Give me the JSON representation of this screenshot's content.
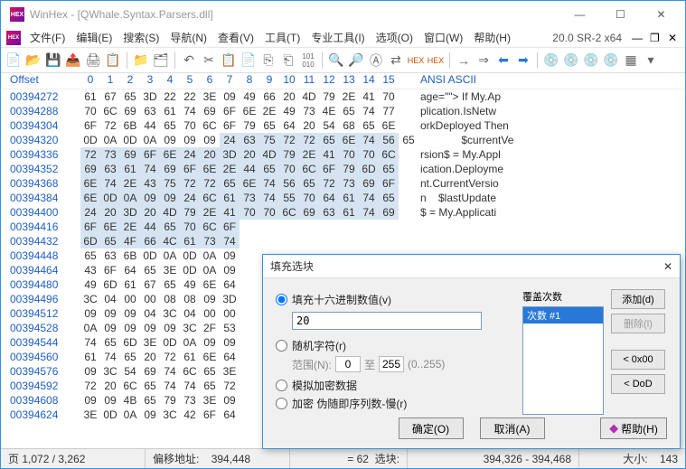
{
  "window": {
    "title": "WinHex - [QWhale.Syntax.Parsers.dll]",
    "version": "20.0 SR-2 x64"
  },
  "menus": [
    "文件(F)",
    "编辑(E)",
    "搜索(S)",
    "导航(N)",
    "查看(V)",
    "工具(T)",
    "专业工具(I)",
    "选项(O)",
    "窗口(W)",
    "帮助(H)"
  ],
  "hex": {
    "offset": "Offset",
    "ansi": "ANSI ASCII",
    "cols": [
      "0",
      "1",
      "2",
      "3",
      "4",
      "5",
      "6",
      "7",
      "8",
      "9",
      "10",
      "11",
      "12",
      "13",
      "14",
      "15"
    ],
    "rows": [
      {
        "o": "00394272",
        "h": [
          "61",
          "67",
          "65",
          "3D",
          "22",
          "22",
          "3E",
          "09",
          "49",
          "66",
          "20",
          "4D",
          "79",
          "2E",
          "41",
          "70"
        ],
        "sel": [],
        "a": "age=\"\"> If My.Ap"
      },
      {
        "o": "00394288",
        "h": [
          "70",
          "6C",
          "69",
          "63",
          "61",
          "74",
          "69",
          "6F",
          "6E",
          "2E",
          "49",
          "73",
          "4E",
          "65",
          "74",
          "77"
        ],
        "sel": [],
        "a": "plication.IsNetw"
      },
      {
        "o": "00394304",
        "h": [
          "6F",
          "72",
          "6B",
          "44",
          "65",
          "70",
          "6C",
          "6F",
          "79",
          "65",
          "64",
          "20",
          "54",
          "68",
          "65",
          "6E"
        ],
        "sel": [],
        "a": "orkDeployed Then"
      },
      {
        "o": "00394320",
        "h": [
          "0D",
          "0A",
          "0D",
          "0A",
          "09",
          "09",
          "09",
          "24",
          "63",
          "75",
          "72",
          "72",
          "65",
          "6E",
          "74",
          "56",
          "65"
        ],
        "sel": [
          7,
          8,
          9,
          10,
          11,
          12,
          13,
          14,
          15
        ],
        "a": "       $currentVe"
      },
      {
        "o": "00394336",
        "h": [
          "72",
          "73",
          "69",
          "6F",
          "6E",
          "24",
          "20",
          "3D",
          "20",
          "4D",
          "79",
          "2E",
          "41",
          "70",
          "70",
          "6C"
        ],
        "sel": [
          0,
          1,
          2,
          3,
          4,
          5,
          6,
          7,
          8,
          9,
          10,
          11,
          12,
          13,
          14,
          15
        ],
        "a": "rsion$ = My.Appl"
      },
      {
        "o": "00394352",
        "h": [
          "69",
          "63",
          "61",
          "74",
          "69",
          "6F",
          "6E",
          "2E",
          "44",
          "65",
          "70",
          "6C",
          "6F",
          "79",
          "6D",
          "65"
        ],
        "sel": [
          0,
          1,
          2,
          3,
          4,
          5,
          6,
          7,
          8,
          9,
          10,
          11,
          12,
          13,
          14,
          15
        ],
        "a": "ication.Deployme"
      },
      {
        "o": "00394368",
        "h": [
          "6E",
          "74",
          "2E",
          "43",
          "75",
          "72",
          "72",
          "65",
          "6E",
          "74",
          "56",
          "65",
          "72",
          "73",
          "69",
          "6F"
        ],
        "sel": [
          0,
          1,
          2,
          3,
          4,
          5,
          6,
          7,
          8,
          9,
          10,
          11,
          12,
          13,
          14,
          15
        ],
        "a": "nt.CurrentVersio"
      },
      {
        "o": "00394384",
        "h": [
          "6E",
          "0D",
          "0A",
          "09",
          "09",
          "24",
          "6C",
          "61",
          "73",
          "74",
          "55",
          "70",
          "64",
          "61",
          "74",
          "65"
        ],
        "sel": [
          0,
          1,
          2,
          3,
          4,
          5,
          6,
          7,
          8,
          9,
          10,
          11,
          12,
          13,
          14,
          15
        ],
        "a": "n    $lastUpdate"
      },
      {
        "o": "00394400",
        "h": [
          "24",
          "20",
          "3D",
          "20",
          "4D",
          "79",
          "2E",
          "41",
          "70",
          "70",
          "6C",
          "69",
          "63",
          "61",
          "74",
          "69"
        ],
        "sel": [
          0,
          1,
          2,
          3,
          4,
          5,
          6,
          7,
          8,
          9,
          10,
          11,
          12,
          13,
          14,
          15
        ],
        "a": "$ = My.Applicati"
      },
      {
        "o": "00394416",
        "h": [
          "6F",
          "6E",
          "2E",
          "44",
          "65",
          "70",
          "6C",
          "6F"
        ],
        "sel": [
          0,
          1,
          2,
          3,
          4,
          5,
          6,
          7
        ],
        "a": ""
      },
      {
        "o": "00394432",
        "h": [
          "6D",
          "65",
          "4F",
          "66",
          "4C",
          "61",
          "73",
          "74"
        ],
        "sel": [
          0,
          1,
          2,
          3,
          4,
          5,
          6,
          7
        ],
        "a": ""
      },
      {
        "o": "00394448",
        "h": [
          "65",
          "63",
          "6B",
          "0D",
          "0A",
          "0D",
          "0A",
          "09"
        ],
        "sel": [],
        "a": ""
      },
      {
        "o": "00394464",
        "h": [
          "43",
          "6F",
          "64",
          "65",
          "3E",
          "0D",
          "0A",
          "09"
        ],
        "sel": [],
        "a": ""
      },
      {
        "o": "00394480",
        "h": [
          "49",
          "6D",
          "61",
          "67",
          "65",
          "49",
          "6E",
          "64"
        ],
        "sel": [],
        "a": ""
      },
      {
        "o": "00394496",
        "h": [
          "3C",
          "04",
          "00",
          "00",
          "08",
          "08",
          "09",
          "3D"
        ],
        "sel": [],
        "a": ""
      },
      {
        "o": "00394512",
        "h": [
          "09",
          "09",
          "09",
          "04",
          "3C",
          "04",
          "00",
          "00"
        ],
        "sel": [],
        "a": ""
      },
      {
        "o": "00394528",
        "h": [
          "0A",
          "09",
          "09",
          "09",
          "09",
          "3C",
          "2F",
          "53"
        ],
        "sel": [],
        "a": ""
      },
      {
        "o": "00394544",
        "h": [
          "74",
          "65",
          "6D",
          "3E",
          "0D",
          "0A",
          "09",
          "09"
        ],
        "sel": [],
        "a": ""
      },
      {
        "o": "00394560",
        "h": [
          "61",
          "74",
          "65",
          "20",
          "72",
          "61",
          "6E",
          "64"
        ],
        "sel": [],
        "a": ""
      },
      {
        "o": "00394576",
        "h": [
          "09",
          "3C",
          "54",
          "69",
          "74",
          "6C",
          "65",
          "3E"
        ],
        "sel": [],
        "a": ""
      },
      {
        "o": "00394592",
        "h": [
          "72",
          "20",
          "6C",
          "65",
          "74",
          "74",
          "65",
          "72"
        ],
        "sel": [],
        "a": ""
      },
      {
        "o": "00394608",
        "h": [
          "09",
          "09",
          "4B",
          "65",
          "79",
          "73",
          "3E",
          "09"
        ],
        "sel": [],
        "a": ""
      },
      {
        "o": "00394624",
        "h": [
          "3E",
          "0D",
          "0A",
          "09",
          "3C",
          "42",
          "6F",
          "64"
        ],
        "sel": [],
        "a": ""
      }
    ]
  },
  "dialog": {
    "title": "填充选块",
    "optHex": "填充十六进制数值(v)",
    "hexValue": "20",
    "optRand": "随机字符(r)",
    "range": "范围(N):",
    "from": "0",
    "toLbl": "至",
    "to": "255",
    "hint": "(0..255)",
    "optSim": "模拟加密数据",
    "optEnc": "加密 伪随即序列数-慢(r)",
    "passesLbl": "覆盖次数",
    "pass1": "次数 #1",
    "add": "添加(d)",
    "del": "删除(l)",
    "zero": "< 0x00",
    "dod": "< DoD",
    "ok": "确定(O)",
    "cancel": "取消(A)",
    "help": "帮助(H)"
  },
  "status": {
    "page": "页 1,072 / 3,262",
    "offLbl": "偏移地址:",
    "off": "394,448",
    "selLbl": "选块:",
    "sel": "= 62",
    "rangeLbl": "",
    "range": "394,326 - 394,468",
    "sizeLbl": "大小:",
    "size": "143"
  }
}
